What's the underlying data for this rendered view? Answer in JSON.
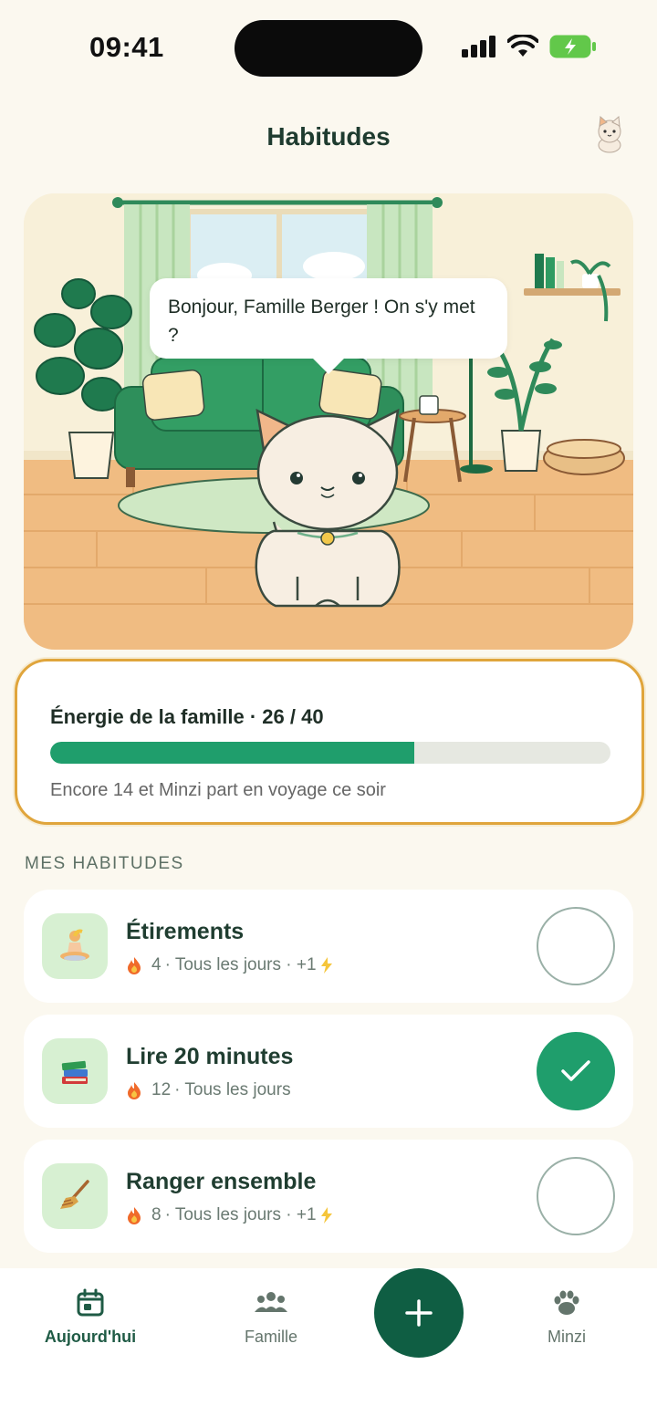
{
  "status": {
    "time": "09:41"
  },
  "header": {
    "title": "Habitudes"
  },
  "scene": {
    "speech": "Bonjour, Famille Berger ! On s'y met ?"
  },
  "energy": {
    "title": "Énergie de la famille · 26 / 40",
    "current": 26,
    "max": 40,
    "note": "Encore 14 et Minzi part en voyage ce soir"
  },
  "section": {
    "label": "MES HABITUDES"
  },
  "habits": [
    {
      "name": "Étirements",
      "icon": "lotus-position-icon",
      "streak": "4",
      "meta": "· Tous les jours · +1",
      "bonus": true,
      "done": false
    },
    {
      "name": "Lire 20 minutes",
      "icon": "books-icon",
      "streak": "12",
      "meta": "· Tous les jours",
      "bonus": false,
      "done": true
    },
    {
      "name": "Ranger ensemble",
      "icon": "broom-icon",
      "streak": "8",
      "meta": "· Tous les jours · +1",
      "bonus": true,
      "done": false
    }
  ],
  "nav": {
    "today": "Aujourd'hui",
    "family": "Famille",
    "minzi": "Minzi"
  },
  "colors": {
    "accent": "#1f9e6c",
    "dark_green": "#0f5e43",
    "highlight": "#e0a53c"
  }
}
